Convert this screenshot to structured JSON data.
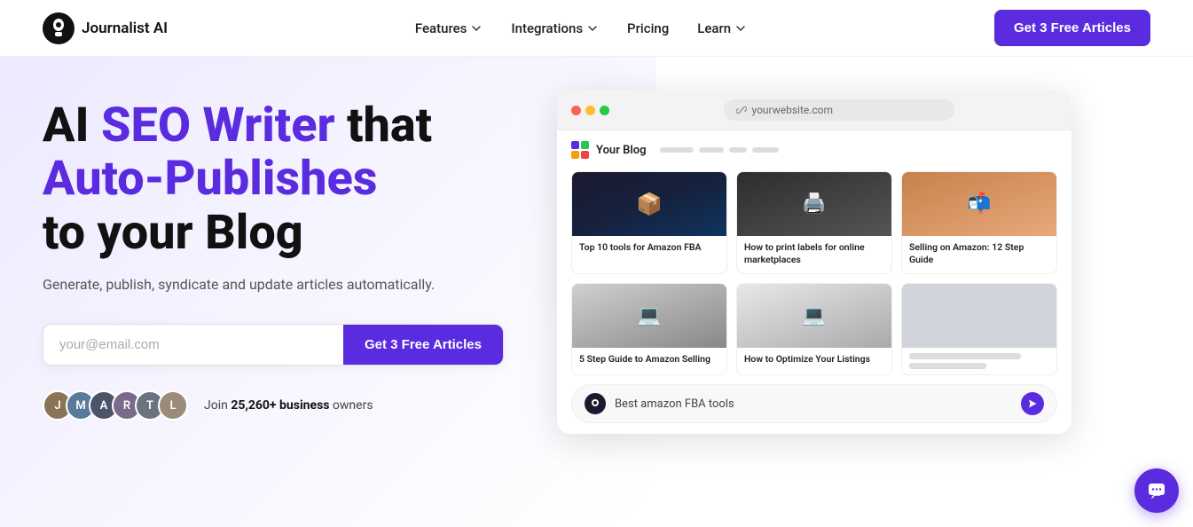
{
  "navbar": {
    "logo_text": "Journalist AI",
    "nav_items": [
      {
        "label": "Features",
        "has_dropdown": true
      },
      {
        "label": "Integrations",
        "has_dropdown": true
      },
      {
        "label": "Pricing",
        "has_dropdown": false
      },
      {
        "label": "Learn",
        "has_dropdown": true
      }
    ],
    "cta_label": "Get 3 Free Articles"
  },
  "hero": {
    "headline_part1": "AI ",
    "headline_purple": "SEO Writer",
    "headline_part2": " that",
    "headline_line2": "Auto-Publishes",
    "headline_line3": "to your Blog",
    "subtext": "Generate, publish, syndicate and update articles automatically.",
    "email_placeholder": "your@email.com",
    "cta_label": "Get 3 Free Articles",
    "social_proof_text": "Join ",
    "social_proof_bold": "25,260+ business",
    "social_proof_suffix": " owners"
  },
  "browser": {
    "url": "yourwebsite.com",
    "blog_name": "Your Blog",
    "articles": [
      {
        "title": "Top 10 tools for Amazon FBA",
        "img_type": "amazon-boxes"
      },
      {
        "title": "How to print labels for online marketplaces",
        "img_type": "printer"
      },
      {
        "title": "Selling on Amazon: 12 Step Guide",
        "img_type": "delivery"
      },
      {
        "title": "5 Step Guide to Amazon Selling",
        "img_type": "laptop"
      },
      {
        "title": "How to Optimize Your Listings",
        "img_type": "laptop2"
      },
      {
        "title": "",
        "img_type": "placeholder"
      }
    ],
    "chat_input": "Best amazon FBA tools"
  },
  "chat_bubble": {
    "label": "chat"
  }
}
